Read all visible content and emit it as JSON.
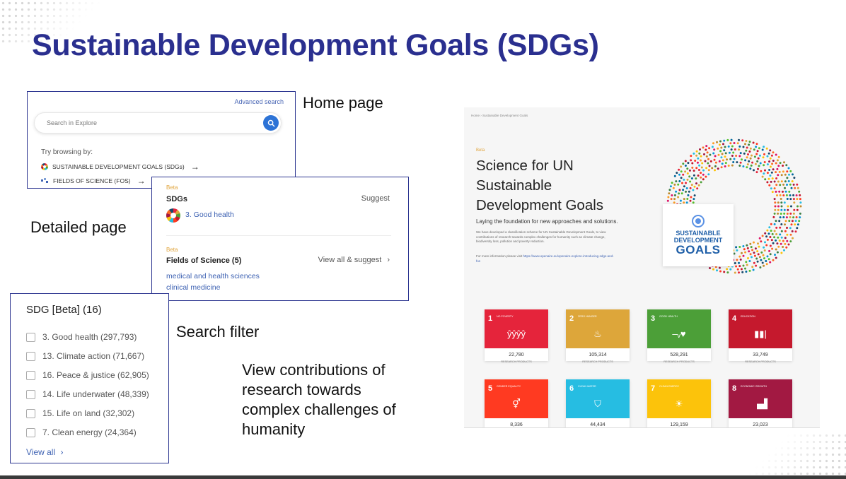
{
  "slide": {
    "title": "Sustainable Development Goals (SDGs)"
  },
  "captions": {
    "home": "Home page",
    "detailed": "Detailed page",
    "filter": "Search filter",
    "summary": "View contributions of research towards complex challenges of humanity",
    "summary_lines": [
      "View contributions of",
      "research towards",
      "complex challenges of",
      "humanity"
    ]
  },
  "home_panel": {
    "advanced_search": "Advanced search",
    "search_placeholder": "Search in Explore",
    "try_browsing": "Try browsing by:",
    "browse_items": [
      {
        "label": "SUSTAINABLE DEVELOPMENT GOALS (SDGs)",
        "arrow": "→"
      },
      {
        "label": "FIELDS OF SCIENCE (FOS)",
        "arrow": "→"
      }
    ]
  },
  "detail_panel": {
    "sdgs_beta": "Beta",
    "sdgs_title": "SDGs",
    "suggest": "Suggest",
    "sdg_item": "3. Good health",
    "fos_beta": "Beta",
    "fos_title": "Fields of Science (5)",
    "fos_action": "View all & suggest",
    "fos_action_chevron": "›",
    "fos_items": [
      "medical and health sciences",
      "clinical medicine"
    ]
  },
  "filter_panel": {
    "title": "SDG [Beta] (16)",
    "items": [
      "3. Good health (297,793)",
      "13. Climate action (71,667)",
      "16. Peace & justice (62,905)",
      "14. Life underwater (48,339)",
      "15. Life on land (32,302)",
      "7. Clean energy (24,364)"
    ],
    "view_all": "View all",
    "view_all_chevron": "›"
  },
  "screenshot": {
    "breadcrumb": "Home  ›  Sustainable Development Goals",
    "beta": "Beta",
    "hero_lines": [
      "Science for UN",
      "Sustainable",
      "Development Goals"
    ],
    "subtitle": "Laying the foundation for new approaches and solutions.",
    "description": "We have developed a classification scheme for UN Sustainable Development Goals, to view contributions of research towards complex challenges for humanity such as climate change, biodiversity loss, pollution and poverty reduction.",
    "more_info_prefix": "For more information please visit",
    "more_info_link": "https://www.openaire.eu/openaire-explore-introducing-sdgs-and-fos",
    "logo": {
      "line1": "SUSTAINABLE",
      "line2": "DEVELOPMENT",
      "line3": "GOALS"
    },
    "cards": [
      {
        "num": "1",
        "name": "No Poverty",
        "count": "22,780",
        "label": "RESEARCH PRODUCTS",
        "color": "#e5243b",
        "glyph": "ŷŷŷŷ"
      },
      {
        "num": "2",
        "name": "Zero Hunger",
        "count": "105,314",
        "label": "RESEARCH PRODUCTS",
        "color": "#dda63a",
        "glyph": "♨"
      },
      {
        "num": "3",
        "name": "Good Health",
        "count": "528,291",
        "label": "RESEARCH PRODUCTS",
        "color": "#4c9f38",
        "glyph": "–ᵥ♥"
      },
      {
        "num": "4",
        "name": "Education",
        "count": "33,749",
        "label": "RESEARCH PRODUCTS",
        "color": "#c5192d",
        "glyph": "▮▮|"
      },
      {
        "num": "5",
        "name": "Gender Equality",
        "count": "8,336",
        "label": "RESEARCH PRODUCTS",
        "color": "#ff3a21",
        "glyph": "⚥"
      },
      {
        "num": "6",
        "name": "Clean Water",
        "count": "44,434",
        "label": "RESEARCH PRODUCTS",
        "color": "#26bde2",
        "glyph": "⛉"
      },
      {
        "num": "7",
        "name": "Clean Energy",
        "count": "129,159",
        "label": "RESEARCH PRODUCTS",
        "color": "#fcc30b",
        "glyph": "☀"
      },
      {
        "num": "8",
        "name": "Economic Growth",
        "count": "23,023",
        "label": "RESEARCH PRODUCTS",
        "color": "#a21942",
        "glyph": "▗▟"
      }
    ]
  },
  "colors": {
    "title": "#2a2f8f",
    "panel_border": "#2c3590",
    "link": "#3f63b3",
    "beta": "#e0a43c"
  }
}
